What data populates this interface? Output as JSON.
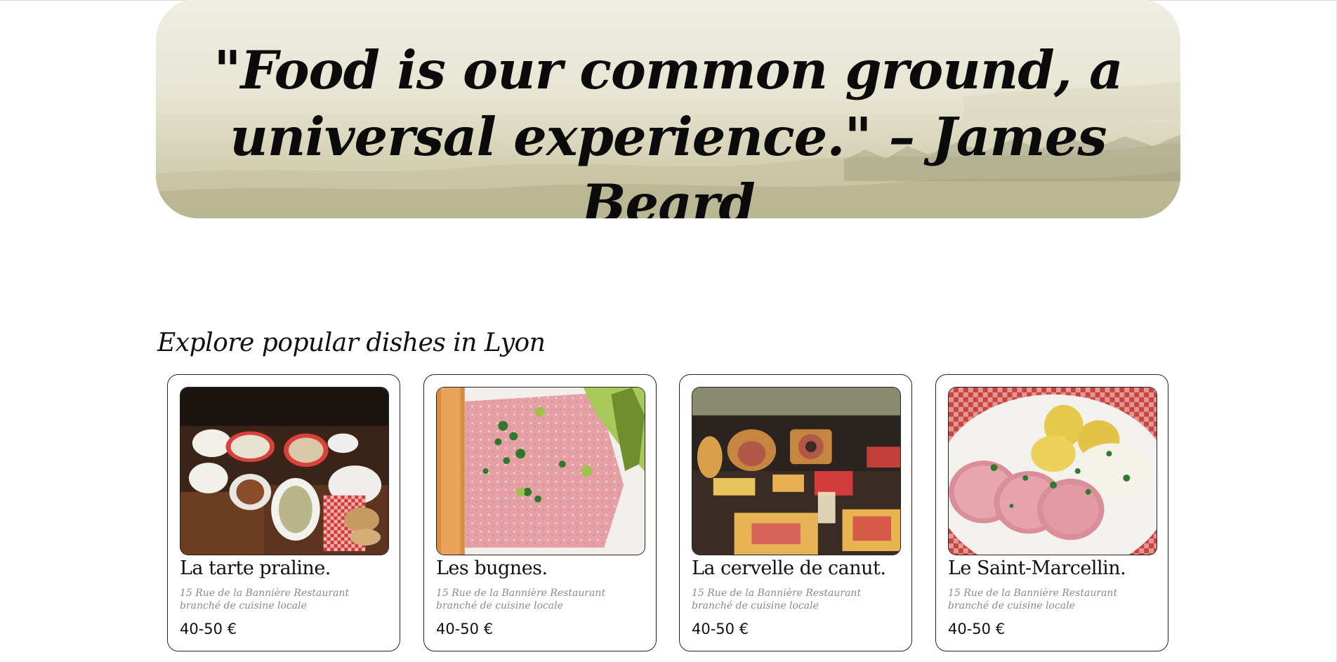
{
  "hero": {
    "quote_line1": "\"Food is our common ground, a",
    "quote_line2": "universal experience.\" – James Beard"
  },
  "section": {
    "title": "Explore popular dishes in Lyon"
  },
  "dishes": [
    {
      "name": "La tarte praline.",
      "description": "15 Rue de la Bannière Restaurant branché de cuisine locale",
      "price": "40-50 €",
      "image": "table-of-dishes-photo"
    },
    {
      "name": "Les bugnes.",
      "description": "15 Rue de la Bannière Restaurant branché de cuisine locale",
      "price": "40-50 €",
      "image": "pate-slice-photo"
    },
    {
      "name": "La cervelle de canut.",
      "description": "15 Rue de la Bannière Restaurant branché de cuisine locale",
      "price": "40-50 €",
      "image": "charcuterie-board-photo"
    },
    {
      "name": "Le Saint-Marcellin.",
      "description": "15 Rue de la Bannière Restaurant branché de cuisine locale",
      "price": "40-50 €",
      "image": "sausage-potatoes-photo"
    }
  ]
}
